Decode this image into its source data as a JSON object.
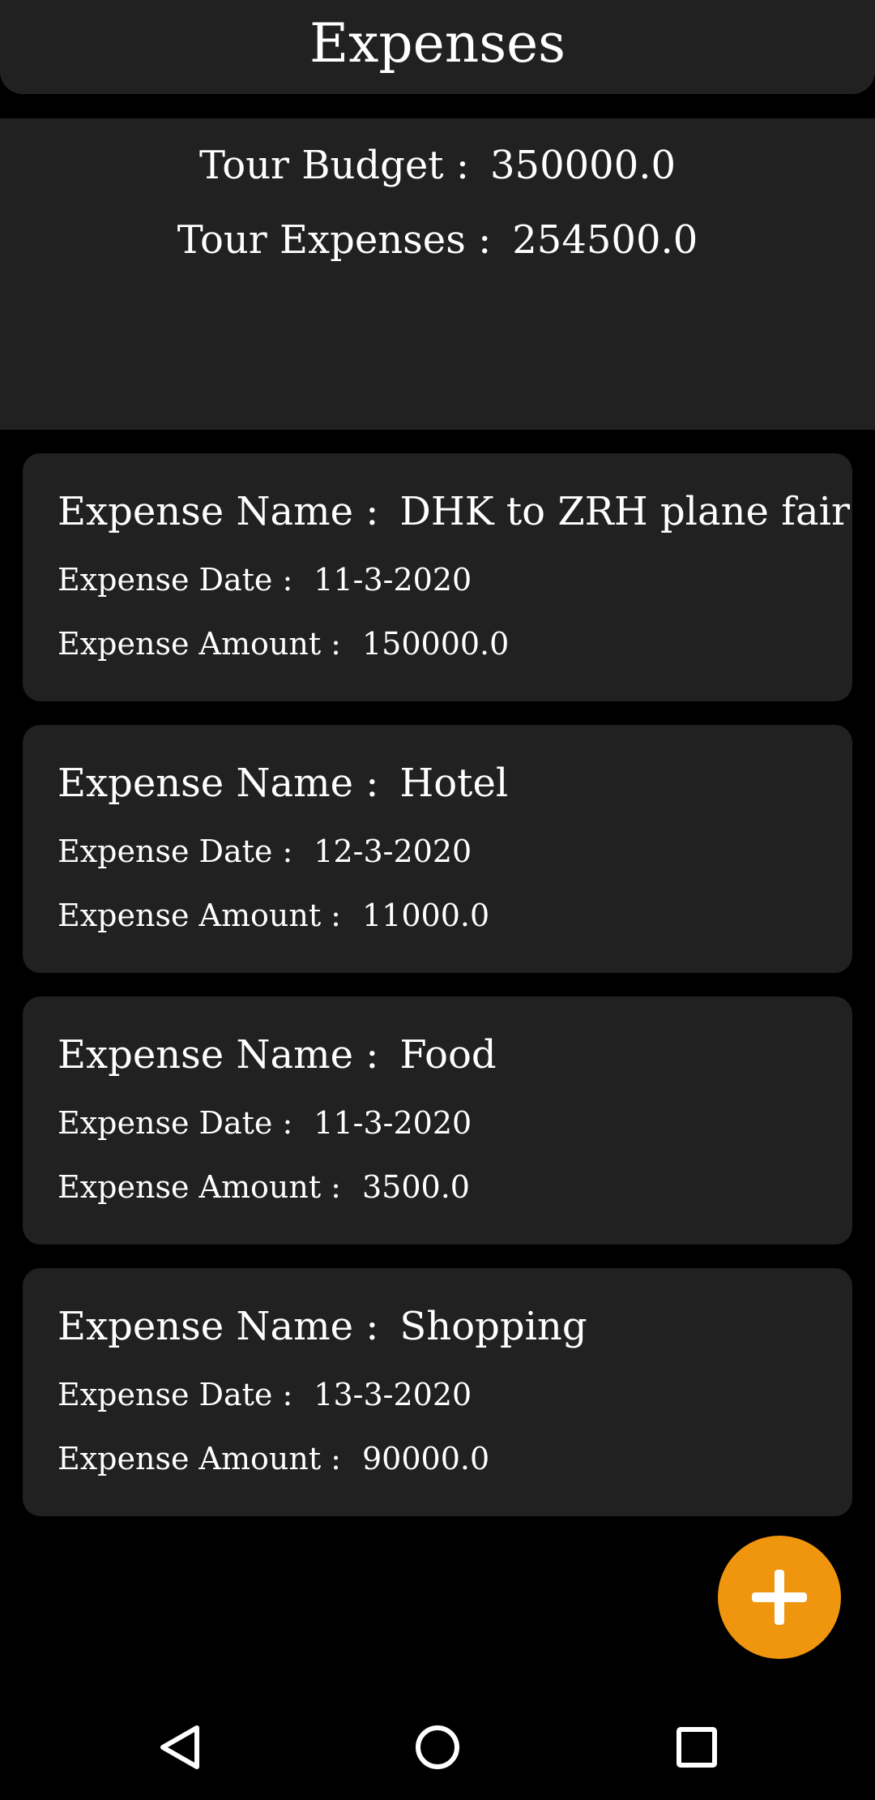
{
  "app_bar": {
    "title": "Expenses"
  },
  "summary": {
    "budget_label": "Tour Budget :",
    "budget_value": "350000.0",
    "expenses_label": "Tour Expenses :",
    "expenses_value": "254500.0"
  },
  "expense_labels": {
    "name": "Expense Name :",
    "date": "Expense Date :",
    "amount": "Expense Amount :"
  },
  "expenses": [
    {
      "name": "DHK to ZRH plane fair",
      "date": "11-3-2020",
      "amount": "150000.0"
    },
    {
      "name": "Hotel",
      "date": "12-3-2020",
      "amount": "11000.0"
    },
    {
      "name": "Food",
      "date": "11-3-2020",
      "amount": "3500.0"
    },
    {
      "name": "Shopping",
      "date": "13-3-2020",
      "amount": "90000.0"
    }
  ],
  "fab": {
    "icon": "plus-icon",
    "color": "#f0960e"
  },
  "nav_bar": {
    "back_icon": "back-triangle-icon",
    "home_icon": "home-circle-icon",
    "recents_icon": "recents-square-icon"
  },
  "colors": {
    "background": "#000000",
    "surface": "#212121",
    "text": "#ffffff",
    "accent": "#f0960e"
  }
}
